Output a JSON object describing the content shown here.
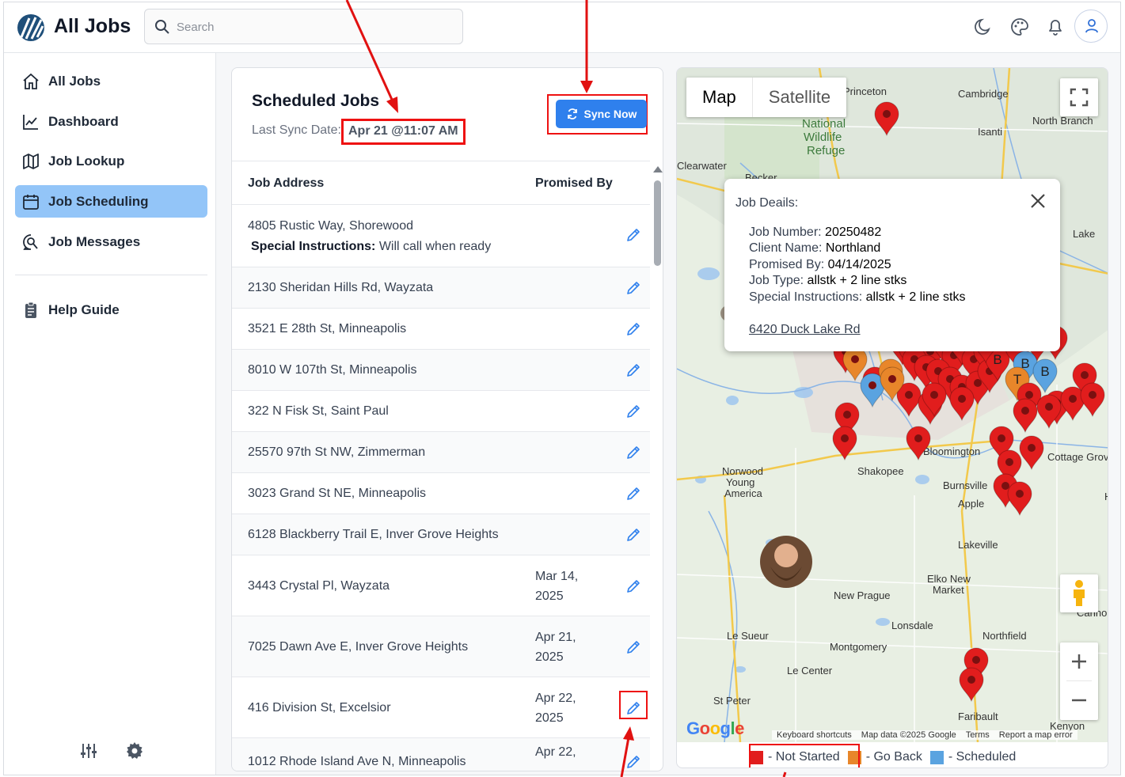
{
  "app": {
    "title": "All Jobs"
  },
  "search": {
    "placeholder": "Search"
  },
  "header": {
    "icons": [
      "moon-icon",
      "palette-icon",
      "bell-icon",
      "user-icon"
    ]
  },
  "sidebar": {
    "items": [
      {
        "label": "All Jobs",
        "icon": "home-icon",
        "active": false
      },
      {
        "label": "Dashboard",
        "icon": "chart-line-icon",
        "active": false
      },
      {
        "label": "Job Lookup",
        "icon": "map-icon",
        "active": false
      },
      {
        "label": "Job Scheduling",
        "icon": "calendar-icon",
        "active": true
      },
      {
        "label": "Job Messages",
        "icon": "message-search-icon",
        "active": false
      },
      {
        "label": "Help Guide",
        "icon": "clipboard-icon",
        "active": false
      }
    ],
    "footer_icons": [
      "sliders-icon",
      "gear-icon"
    ]
  },
  "jobs": {
    "title": "Scheduled Jobs",
    "last_sync_label": "Last Sync Date:",
    "last_sync_value": "Apr 21 @11:07 AM",
    "sync_button": "Sync Now",
    "columns": {
      "address": "Job Address",
      "promised": "Promised By"
    },
    "rows": [
      {
        "address": "4805 Rustic Way, Shorewood",
        "instr_label": "Special Instructions:",
        "instr_value": " Will call when ready",
        "promised_line1": "",
        "promised_line2": ""
      },
      {
        "address": "2130 Sheridan Hills Rd, Wayzata",
        "promised_line1": "",
        "promised_line2": ""
      },
      {
        "address": "3521 E 28th St, Minneapolis",
        "promised_line1": "",
        "promised_line2": ""
      },
      {
        "address": "8010 W 107th St, Minneapolis",
        "promised_line1": "",
        "promised_line2": ""
      },
      {
        "address": "322 N Fisk St, Saint Paul",
        "promised_line1": "",
        "promised_line2": ""
      },
      {
        "address": "25570 97th St NW, Zimmerman",
        "promised_line1": "",
        "promised_line2": ""
      },
      {
        "address": "3023 Grand St NE, Minneapolis",
        "promised_line1": "",
        "promised_line2": ""
      },
      {
        "address": "6128 Blackberry Trail E, Inver Grove Heights",
        "promised_line1": "",
        "promised_line2": ""
      },
      {
        "address": "3443 Crystal Pl, Wayzata",
        "promised_line1": "Mar 14,",
        "promised_line2": "2025"
      },
      {
        "address": "7025 Dawn Ave E, Inver Grove Heights",
        "promised_line1": "Apr 21,",
        "promised_line2": "2025"
      },
      {
        "address": "416 Division St, Excelsior",
        "promised_line1": "Apr 22,",
        "promised_line2": "2025"
      },
      {
        "address": "1012 Rhode Island Ave N, Minneapolis",
        "promised_line1": "Apr 22,",
        "promised_line2": ""
      }
    ]
  },
  "map": {
    "tabs": [
      "Map",
      "Satellite"
    ],
    "info": {
      "title": "Job Deails:",
      "job_number_label": "Job Number:",
      "job_number": " 20250482",
      "client_label": "Client Name:",
      "client": " Northland",
      "promised_label": "Promised By:",
      "promised": " 04/14/2025",
      "type_label": "Job Type:",
      "type": " allstk + 2 line stks",
      "instr_label": "Special Instructions:",
      "instr": " allstk + 2 line stks",
      "link": "6420 Duck Lake Rd"
    },
    "place_labels": [
      "Princeton",
      "Cambridge",
      "North Branch",
      "Isanti",
      "National Wildlife Refuge",
      "Clearwater",
      "Becker",
      "Lake",
      "Bloomington",
      "Cottage Grove",
      "Shakopee",
      "Norwood Young America",
      "Burnsville",
      "Apple",
      "Lakeville",
      "Elko New Market",
      "New Prague",
      "Le Sueur",
      "Lonsdale",
      "Montgomery",
      "Northfield",
      "Le Center",
      "St Peter",
      "Faribault",
      "Kenyon",
      "Cannon",
      "Ha",
      "Wildlife"
    ],
    "footer": [
      "Keyboard shortcuts",
      "Map data ©2025 Google",
      "Terms",
      "Report a map error"
    ],
    "google_logo": "Google",
    "legend": [
      {
        "label": "- Not Started",
        "color": "#e11d1d"
      },
      {
        "label": "- Go Back",
        "color": "#e8862a"
      },
      {
        "label": "- Scheduled",
        "color": "#5aa3e0"
      }
    ],
    "marker_letters": [
      "B",
      "B",
      "B",
      "T",
      "B"
    ]
  },
  "colors": {
    "accent": "#2f80ed",
    "active_nav": "#93c5f8",
    "annotation": "#e11111"
  }
}
